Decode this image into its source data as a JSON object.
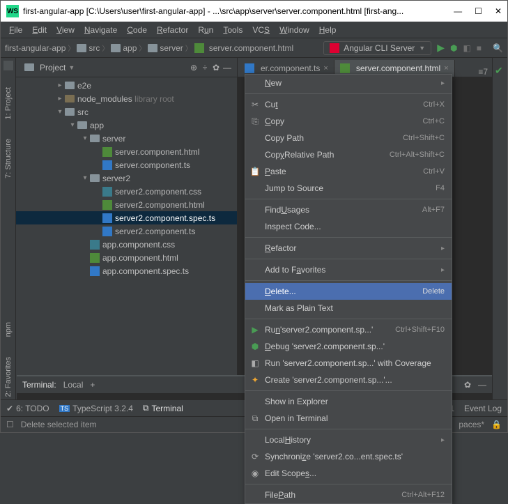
{
  "window": {
    "title": "first-angular-app [C:\\Users\\user\\first-angular-app] - ...\\src\\app\\server\\server.component.html [first-ang...",
    "ws": "WS"
  },
  "menu": {
    "file": "File",
    "edit": "Edit",
    "view": "View",
    "navigate": "Navigate",
    "code": "Code",
    "refactor": "Refactor",
    "run": "Run",
    "tools": "Tools",
    "vcs": "VCS",
    "window": "Window",
    "help": "Help"
  },
  "crumbs": {
    "c0": "first-angular-app",
    "c1": "src",
    "c2": "app",
    "c3": "server",
    "c4": "server.component.html"
  },
  "runcfg": {
    "label": "Angular CLI Server"
  },
  "sidebar": {
    "header": "Project",
    "tools": {
      "project": "1: Project",
      "structure": "7: Structure",
      "favorites": "2: Favorites",
      "npm": "npm"
    }
  },
  "tree": {
    "e2e": "e2e",
    "node_modules": "node_modules",
    "libroot": "library root",
    "src": "src",
    "app": "app",
    "server": "server",
    "server_html": "server.component.html",
    "server_ts": "server.component.ts",
    "server2": "server2",
    "server2_css": "server2.component.css",
    "server2_html": "server2.component.html",
    "server2_spec": "server2.component.spec.ts",
    "server2_ts": "server2.component.ts",
    "app_css": "app.component.css",
    "app_html": "app.component.html",
    "app_spec": "app.component.spec.ts"
  },
  "tabs": {
    "t0": "er.component.ts",
    "t1": "server.component.html"
  },
  "terminal": {
    "label": "Terminal:",
    "tab": "Local",
    "plus": "+"
  },
  "toolwin": {
    "todo": "6: TODO",
    "ts": "TypeScript 3.2.4",
    "terminal": "Terminal"
  },
  "status": {
    "hint": "Delete selected item",
    "spaces": "paces*",
    "eventlog": "Event Log",
    "editor": "≡7"
  },
  "ctx": {
    "new": "New",
    "cut": "Cut",
    "cut_sc": "Ctrl+X",
    "copy": "Copy",
    "copy_sc": "Ctrl+C",
    "copypath": "Copy Path",
    "copypath_sc": "Ctrl+Shift+C",
    "copyrel": "Copy Relative Path",
    "copyrel_sc": "Ctrl+Alt+Shift+C",
    "paste": "Paste",
    "paste_sc": "Ctrl+V",
    "jump": "Jump to Source",
    "jump_sc": "F4",
    "findusages": "Find Usages",
    "findusages_sc": "Alt+F7",
    "inspect": "Inspect Code...",
    "refactor": "Refactor",
    "addfav": "Add to Favorites",
    "delete": "Delete...",
    "delete_sc": "Delete",
    "mark": "Mark as Plain Text",
    "run": "Run 'server2.component.sp...'",
    "run_sc": "Ctrl+Shift+F10",
    "debug": "Debug 'server2.component.sp...'",
    "coverage": "Run 'server2.component.sp...' with Coverage",
    "create": "Create 'server2.component.sp...'...",
    "explorer": "Show in Explorer",
    "openterm": "Open in Terminal",
    "localhist": "Local History",
    "sync": "Synchronize 'server2.co...ent.spec.ts'",
    "editscopes": "Edit Scopes...",
    "filepath": "File Path",
    "filepath_sc": "Ctrl+Alt+F12"
  }
}
